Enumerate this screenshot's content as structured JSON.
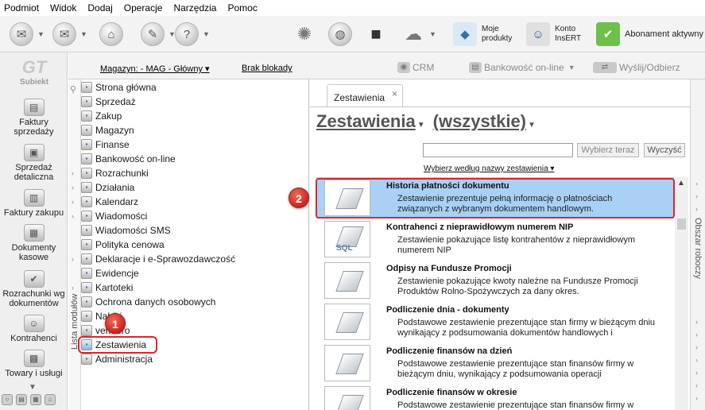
{
  "menu": [
    "Podmiot",
    "Widok",
    "Dodaj",
    "Operacje",
    "Narzędzia",
    "Pomoc"
  ],
  "toolbar": {
    "moje_produkty": "Moje produkty",
    "konto_insert": "Konto InsERT",
    "abonament": "Abonament aktywny"
  },
  "logo": {
    "mark": "GT",
    "name": "Subiekt"
  },
  "leftnav": [
    {
      "label": "Faktury sprzedaży",
      "icon": "invoice-icon"
    },
    {
      "label": "Sprzedaż detaliczna",
      "icon": "retail-icon"
    },
    {
      "label": "Faktury zakupu",
      "icon": "purchase-icon"
    },
    {
      "label": "Dokumenty kasowe",
      "icon": "cash-icon"
    },
    {
      "label": "Rozrachunki wg dokumentów",
      "icon": "settlement-icon"
    },
    {
      "label": "Kontrahenci",
      "icon": "contractor-icon"
    },
    {
      "label": "Towary i usługi",
      "icon": "goods-icon"
    }
  ],
  "subbar": {
    "magazyn": "Magazyn: - MAG - Główny",
    "brak_blokady": "Brak blokady",
    "crm": "CRM",
    "bankowosc": "Bankowość on-line",
    "wyslij": "Wyślij/Odbierz"
  },
  "modules_label": "Lista modułów",
  "modules": [
    "Strona główna",
    "Sprzedaż",
    "Zakup",
    "Magazyn",
    "Finanse",
    "Bankowość on-line",
    "Rozrachunki",
    "Działania",
    "Kalendarz",
    "Wiadomości",
    "Wiadomości SMS",
    "Polityka cenowa",
    "Deklaracje i e-Sprawozdawczość",
    "Ewidencje",
    "Kartoteki",
    "Ochrona danych osobowych",
    "Nabiki",
    "vendero",
    "Zestawienia",
    "Administracja"
  ],
  "badges": {
    "one": "1",
    "two": "2"
  },
  "main": {
    "tab": "Zestawienia",
    "tab_close": "×",
    "title": "Zestawienia",
    "filter": "(wszystkie)",
    "search_value": "",
    "btn_wybierz": "Wybierz teraz",
    "btn_wyczysc": "Wyczyść",
    "choose_by": "Wybierz według nazwy zestawienia"
  },
  "reports": [
    {
      "title": "Historia płatności dokumentu",
      "desc": "Zestawienie prezentuje pełną informację o płatnościach związanych z wybranym dokumentem handlowym."
    },
    {
      "title": "Kontrahenci z nieprawidłowym numerem NIP",
      "desc": "Zestawienie pokazujące listę kontrahentów z nieprawidłowym numerem NIP"
    },
    {
      "title": "Odpisy na Fundusze Promocji",
      "desc": "Zestawienie pokazujące kwoty należne na Fundusze Promocji Produktów Rolno-Spożywczych za dany okres."
    },
    {
      "title": "Podliczenie dnia - dokumenty",
      "desc": "Podstawowe zestawienie prezentujące stan firmy w bieżącym dniu wynikający z podsumowania dokumentów handlowych i"
    },
    {
      "title": "Podliczenie finansów na dzień",
      "desc": "Podstawowe zestawienie prezentujące stan finansów firmy w bieżącym dniu, wynikający z podsumowania operacji"
    },
    {
      "title": "Podliczenie finansów w okresie",
      "desc": "Podstawowe zestawienie prezentujące stan finansów firmy w"
    }
  ],
  "right_panel_label": "Obszar roboczy",
  "sql_label": "SQL",
  "colors": {
    "selection": "#a9d1f5",
    "highlight": "#d9262c"
  }
}
